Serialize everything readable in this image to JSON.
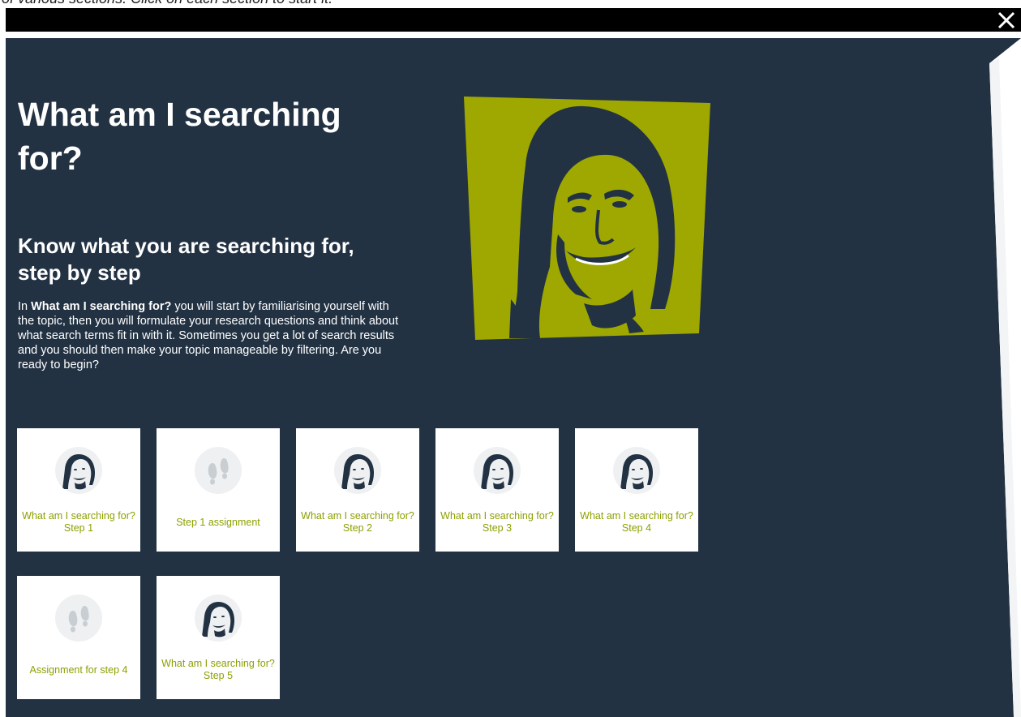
{
  "instruction": "of various sections. Click on each section to start it.",
  "close_label": "Close",
  "module": {
    "title": "What am I searching for?",
    "subtitle": "Know what you are searching for, step by step",
    "intro_prefix": "In ",
    "intro_bold": "What am I searching for?",
    "intro_rest": " you will start by familiarising yourself with the topic, then you will formulate your research questions and think about what search terms fit in with it. Sometimes you get a lot of search results and you should then make your topic manageable by filtering. Are you ready to begin?"
  },
  "colors": {
    "panel": "#223243",
    "accent": "#9ea800",
    "card_label": "#8ea000"
  },
  "sections": [
    {
      "label": "What am I searching for? Step 1",
      "icon": "face-icon"
    },
    {
      "label": "Step 1 assignment",
      "icon": "footprints-icon"
    },
    {
      "label": "What am I searching for? Step 2",
      "icon": "face-icon"
    },
    {
      "label": "What am I searching for? Step 3",
      "icon": "face-icon"
    },
    {
      "label": "What am I searching for? Step 4",
      "icon": "face-icon"
    },
    {
      "label": "Assignment for step 4",
      "icon": "footprints-icon"
    },
    {
      "label": "What am I searching for? Step 5",
      "icon": "face-icon"
    }
  ]
}
